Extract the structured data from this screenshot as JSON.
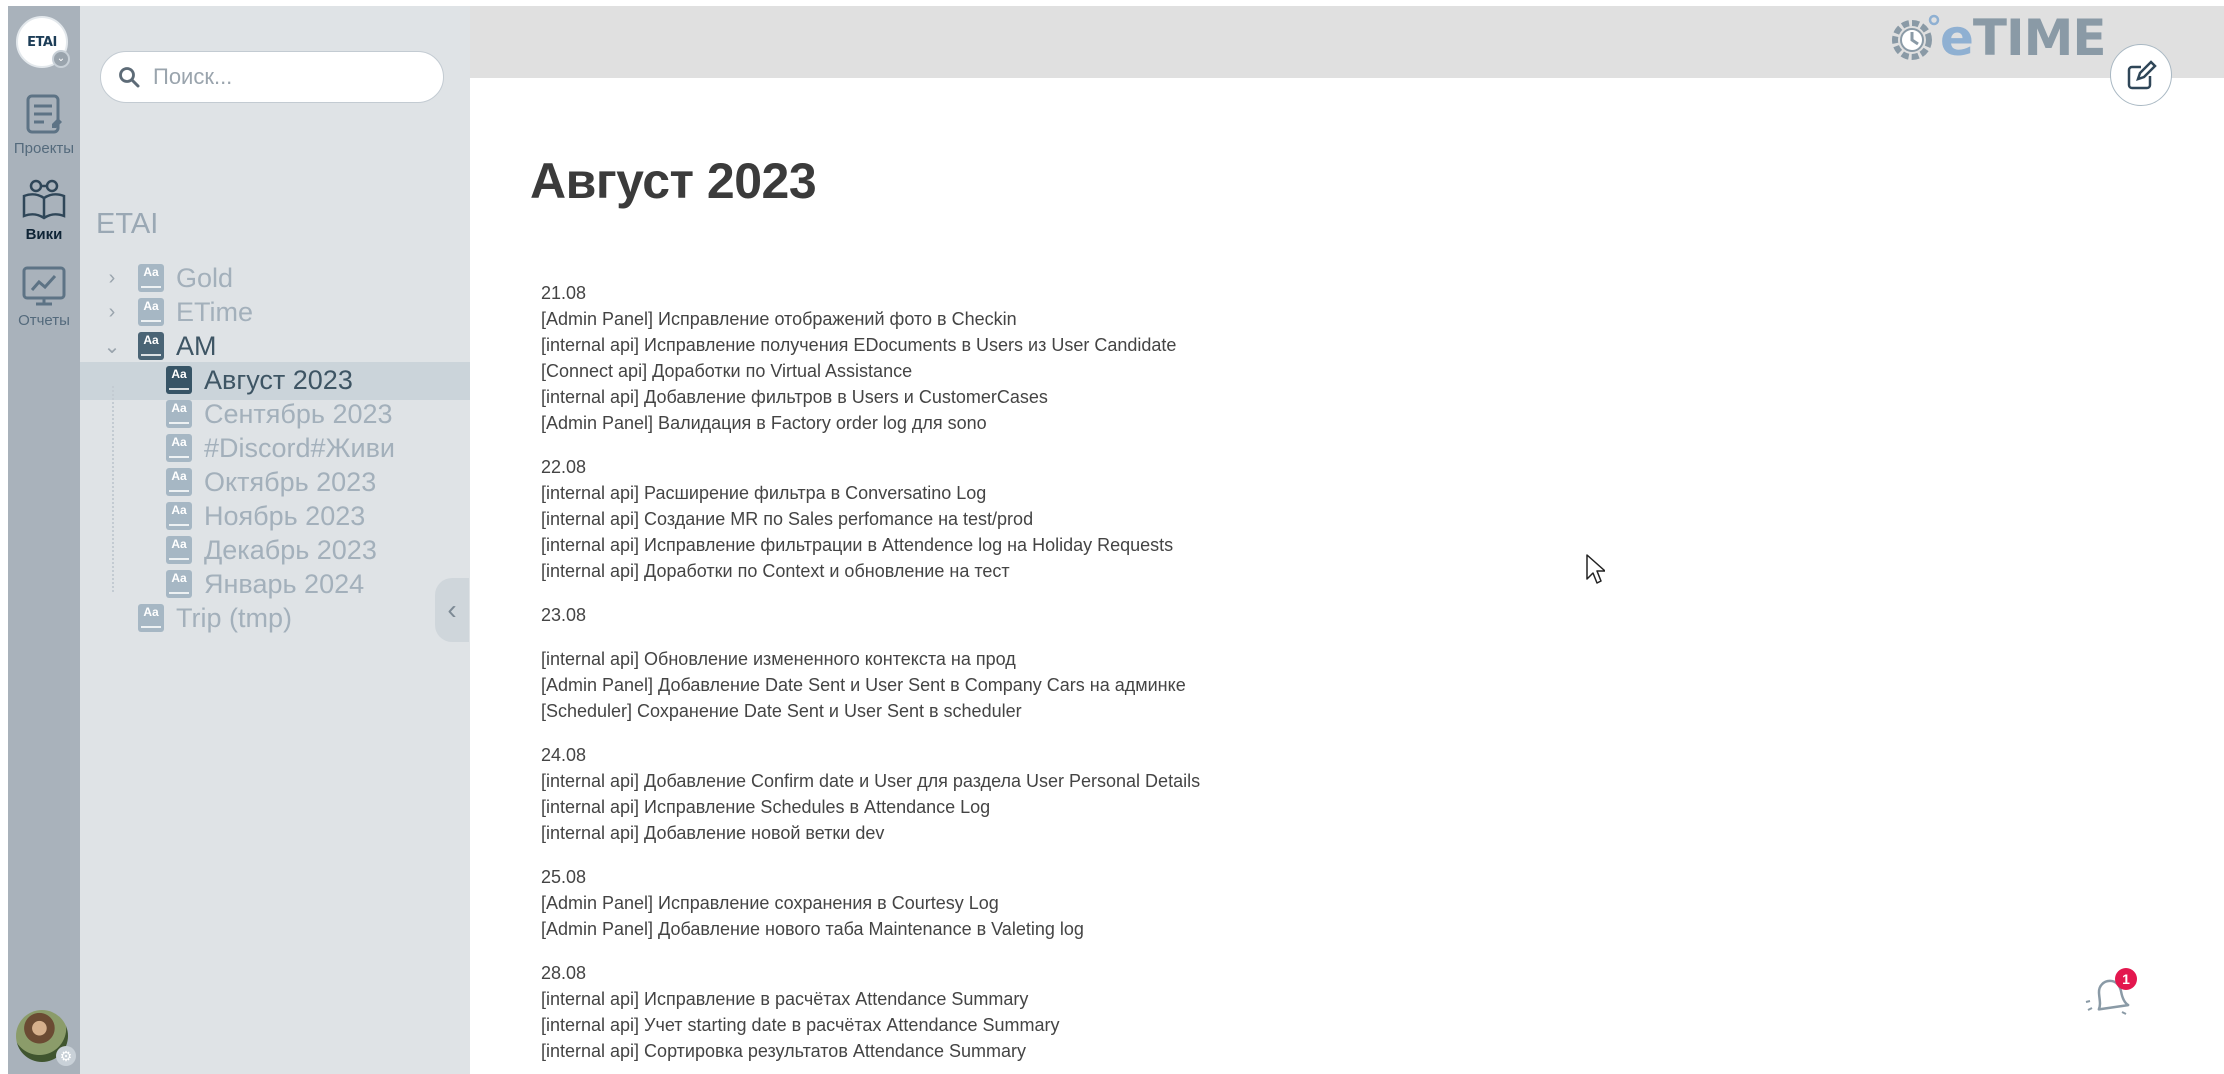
{
  "app": {
    "brand": "eTIME",
    "logo_text": "ETAI"
  },
  "rail": {
    "items": [
      {
        "label": "Проекты",
        "icon": "projects-icon",
        "active": false
      },
      {
        "label": "Вики",
        "icon": "wiki-icon",
        "active": true
      },
      {
        "label": "Отчеты",
        "icon": "reports-icon",
        "active": false
      }
    ]
  },
  "search": {
    "placeholder": "Поиск...",
    "value": ""
  },
  "sidebar": {
    "space_title": "ETAI",
    "tree": [
      {
        "label": "Gold",
        "expandable": true,
        "expanded": false,
        "level": 0
      },
      {
        "label": "ETime",
        "expandable": true,
        "expanded": false,
        "level": 0
      },
      {
        "label": "AM",
        "expandable": true,
        "expanded": true,
        "level": 0
      },
      {
        "label": "Август 2023",
        "level": 1,
        "selected": true
      },
      {
        "label": "Сентябрь 2023",
        "level": 1
      },
      {
        "label": "#Discord#Живи",
        "level": 1
      },
      {
        "label": "Октябрь 2023",
        "level": 1
      },
      {
        "label": "Ноябрь 2023",
        "level": 1
      },
      {
        "label": "Декабрь 2023",
        "level": 1
      },
      {
        "label": "Январь 2024",
        "level": 1
      },
      {
        "label": "Trip (tmp)",
        "expandable": false,
        "level": 0
      }
    ]
  },
  "page": {
    "title": "Август 2023",
    "days": [
      {
        "date": "21.08",
        "entries": [
          "[Admin Panel] Исправление отображений фото в Checkin",
          "[internal api] Исправление получения EDocuments в Users из User Candidate",
          "[Connect api] Доработки по Virtual Assistance",
          "[internal api] Добавление фильтров в Users и CustomerCases",
          "[Admin Panel] Валидация в Factory order log для sono"
        ]
      },
      {
        "date": "22.08",
        "entries": [
          "[internal api] Расширение фильтра в Conversatino Log",
          "[internal api] Создание MR по Sales perfomance на test/prod",
          "[internal api] Исправление фильтрации в Attendence log на Holiday Requests",
          "[internal api] Доработки по Context и обновление на тест"
        ]
      },
      {
        "date": "23.08",
        "entries": [
          "[internal api] Обновление измененного контекста на прод",
          "[Admin Panel] Добавление Date Sent и User Sent в Company Cars на админке",
          "[Scheduler] Сохранение Date Sent и User Sent в scheduler"
        ]
      },
      {
        "date": "24.08",
        "entries": [
          "[internal api] Добавление Confirm date и User для раздела User Personal Details",
          "[internal api] Исправление Schedules в Attendance Log",
          "[internal api] Добавление новой ветки dev"
        ]
      },
      {
        "date": "25.08",
        "entries": [
          "[Admin Panel] Исправление сохранения в Courtesy Log",
          "[Admin Panel] Добавление нового таба Maintenance в Valeting log"
        ]
      },
      {
        "date": "28.08",
        "entries": [
          "[internal api] Исправление в расчётах Attendance Summary",
          "[internal api] Учет starting date в расчётах Attendance Summary",
          "[internal api] Сортировка результатов  Attendance Summary"
        ]
      }
    ]
  },
  "notifications": {
    "count": "1"
  }
}
